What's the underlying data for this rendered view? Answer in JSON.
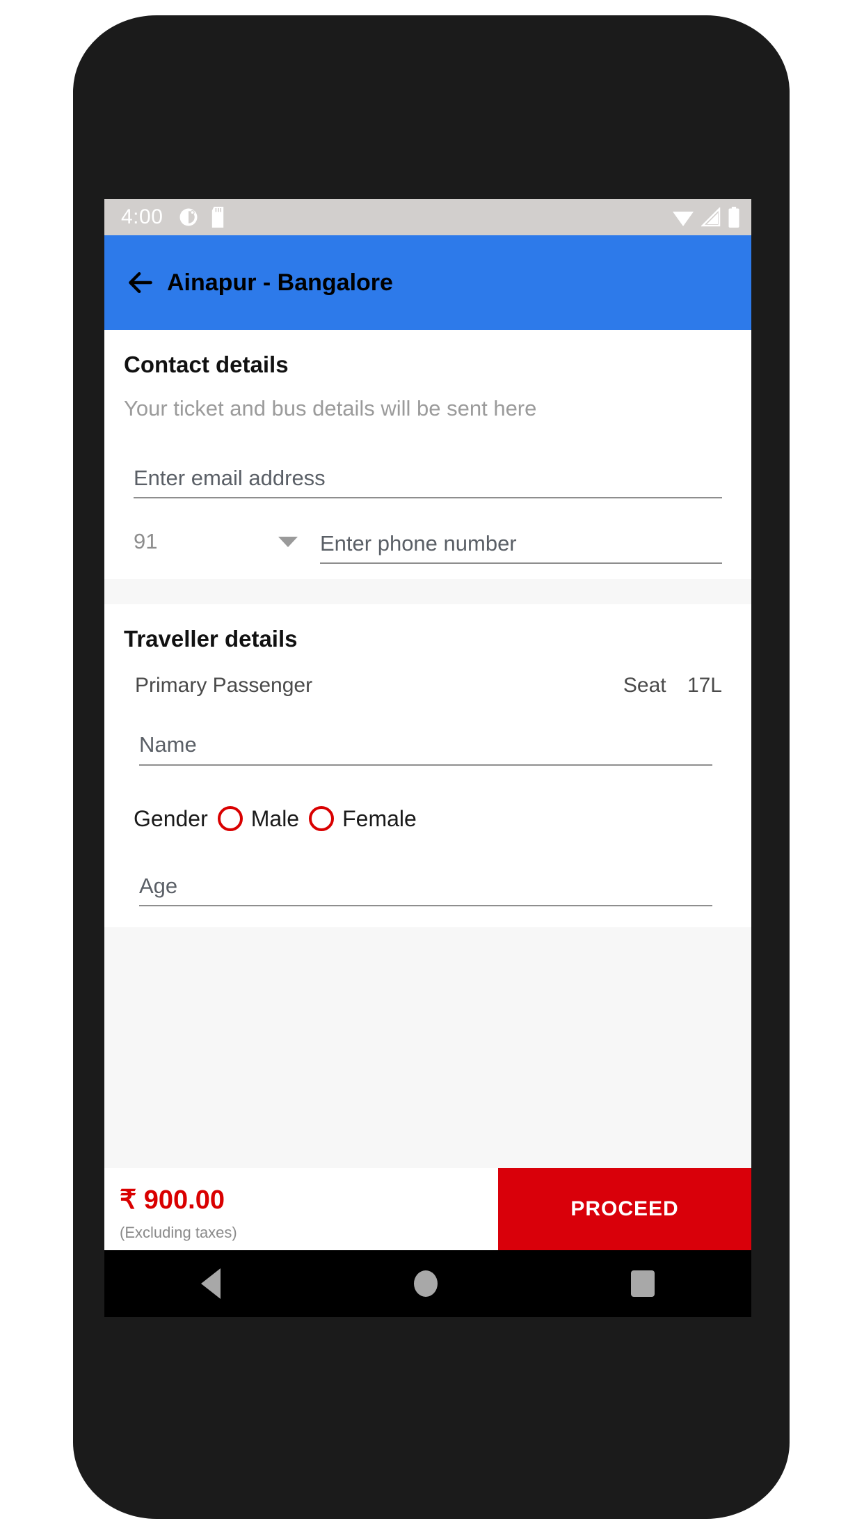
{
  "status_bar": {
    "time": "4:00",
    "left_icons": [
      "alarm-icon",
      "sd-card-icon"
    ],
    "right_icons": [
      "wifi-icon",
      "signal-icon",
      "battery-icon"
    ]
  },
  "app_bar": {
    "back_icon": "back-arrow-icon",
    "title": "Ainapur - Bangalore",
    "background_color": "#2d7aea"
  },
  "contact": {
    "title": "Contact details",
    "subtitle": "Your ticket and bus details will be sent here",
    "email_placeholder": "Enter email address",
    "country_code": "91",
    "phone_placeholder": "Enter phone number"
  },
  "traveller": {
    "title": "Traveller details",
    "passenger_label": "Primary Passenger",
    "seat_label": "Seat",
    "seat_number": "17L",
    "name_placeholder": "Name",
    "gender_label": "Gender",
    "gender_options": [
      {
        "label": "Male"
      },
      {
        "label": "Female"
      }
    ],
    "age_placeholder": "Age",
    "radio_color": "#d90000"
  },
  "bottom_bar": {
    "price": "₹ 900.00",
    "tax_note": "(Excluding taxes)",
    "proceed_label": "PROCEED",
    "price_color": "#d90000",
    "button_color": "#d9000a"
  },
  "nav_bar": {
    "back": "nav-back-icon",
    "home": "nav-home-icon",
    "recents": "nav-recents-icon"
  }
}
